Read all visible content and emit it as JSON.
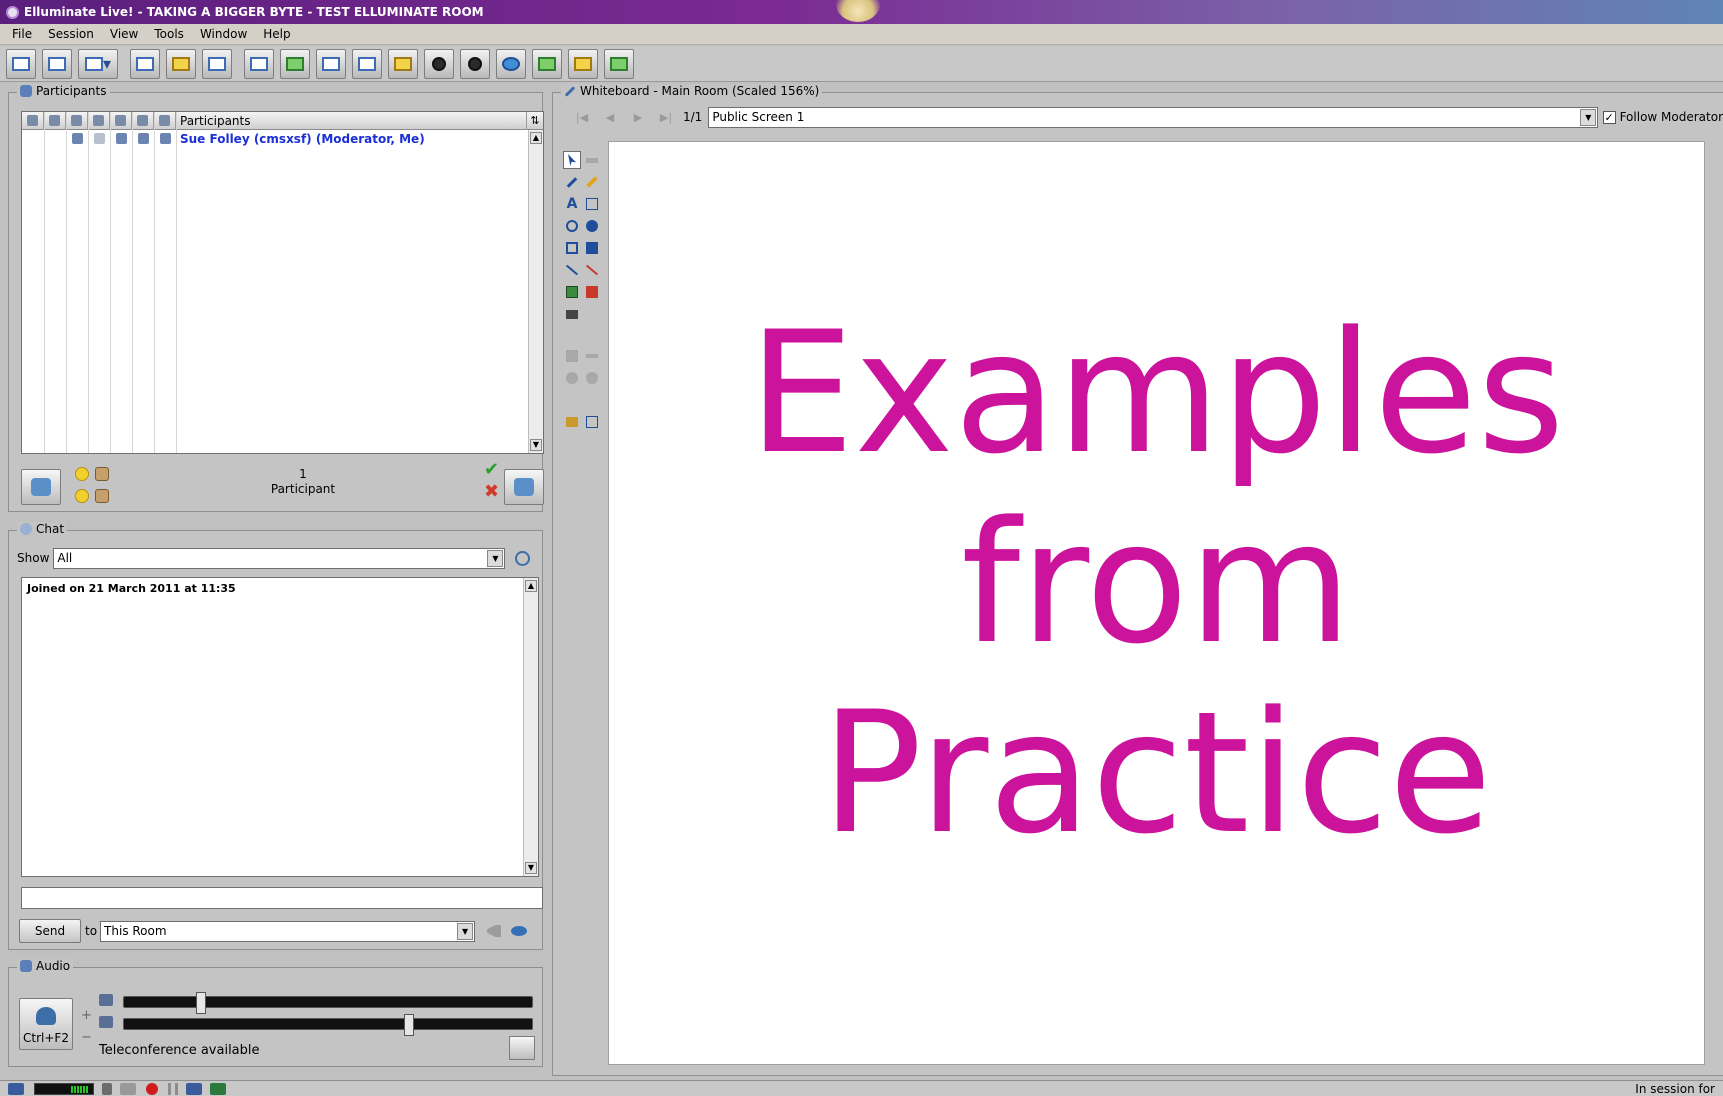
{
  "window": {
    "title": "Elluminate Live! - TAKING A BIGGER BYTE - TEST ELLUMINATE ROOM"
  },
  "menu": [
    "File",
    "Session",
    "View",
    "Tools",
    "Window",
    "Help"
  ],
  "toolbar": {
    "icons": [
      "save-icon",
      "print-icon",
      "layout-icon",
      "participant-info-icon",
      "archive-icon",
      "poll-icon",
      "whiteboard-icon",
      "app-share-icon",
      "multimedia-icon",
      "file-transfer-icon",
      "load-icon",
      "video-icon",
      "video-window-icon",
      "web-tour-icon",
      "timer-icon",
      "notes-icon",
      "add-content-icon"
    ]
  },
  "participants": {
    "panel_title": "Participants",
    "column_header": "Participants",
    "rows": [
      {
        "name": "Sue Folley (cmsxsf) (Moderator, Me)"
      }
    ],
    "count": "1",
    "count_label": "Participant"
  },
  "chat": {
    "panel_title": "Chat",
    "show_label": "Show",
    "show_value": "All",
    "log": [
      "Joined on 21 March 2011 at 11:35"
    ],
    "input_value": "",
    "send_label": "Send",
    "to_label": "to",
    "to_value": "This Room"
  },
  "audio": {
    "panel_title": "Audio",
    "talk_shortcut": "Ctrl+F2",
    "plus": "+",
    "minus": "−",
    "status": "Teleconference available",
    "mic_level": 0.18,
    "speaker_level": 0.7
  },
  "whiteboard": {
    "panel_title": "Whiteboard - Main Room (Scaled 156%)",
    "page": "1/1",
    "screen_value": "Public Screen 1",
    "follow_label": "Follow Moderator",
    "follow_checked": true,
    "follow_check_mark": "✓",
    "slide_lines": [
      "Examples",
      "from",
      "Practice"
    ],
    "slide_color": "#cc139c"
  },
  "statusbar": {
    "right_text": "In session for"
  }
}
